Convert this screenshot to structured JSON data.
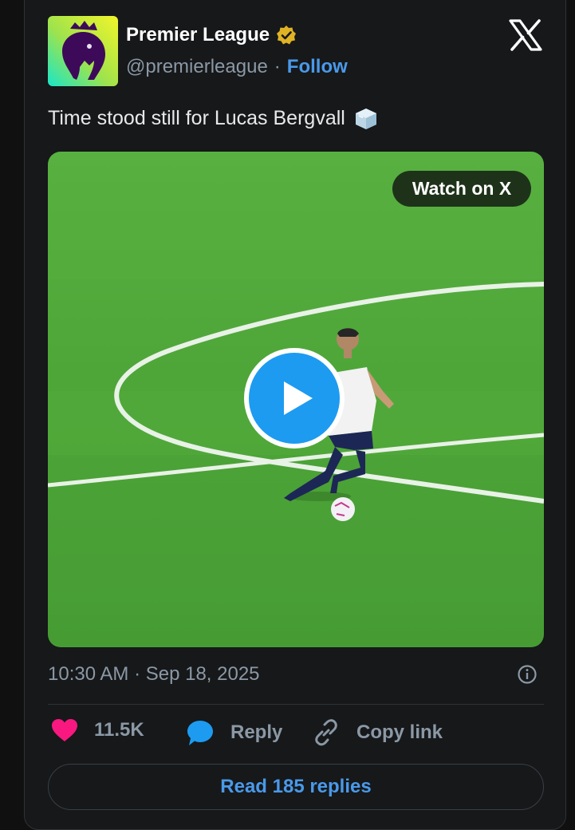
{
  "account": {
    "display_name": "Premier League",
    "handle": "@premierleague",
    "separator": "·",
    "follow_label": "Follow",
    "verified": true
  },
  "tweet": {
    "text": "Time stood still for Lucas Bergvall",
    "emoji_icon": "ice-cube-icon"
  },
  "media": {
    "watch_label": "Watch on X",
    "play_icon": "play-icon"
  },
  "meta": {
    "timestamp": "10:30 AM · Sep 18, 2025"
  },
  "actions": {
    "likes_count": "11.5K",
    "reply_label": "Reply",
    "copy_label": "Copy link"
  },
  "footer": {
    "read_replies_label": "Read 185 replies"
  },
  "colors": {
    "accent": "#4a99e9",
    "like": "#f91880",
    "play": "#1d9bf0",
    "verified": "#e0b325",
    "pitch": "#4fa83a"
  }
}
